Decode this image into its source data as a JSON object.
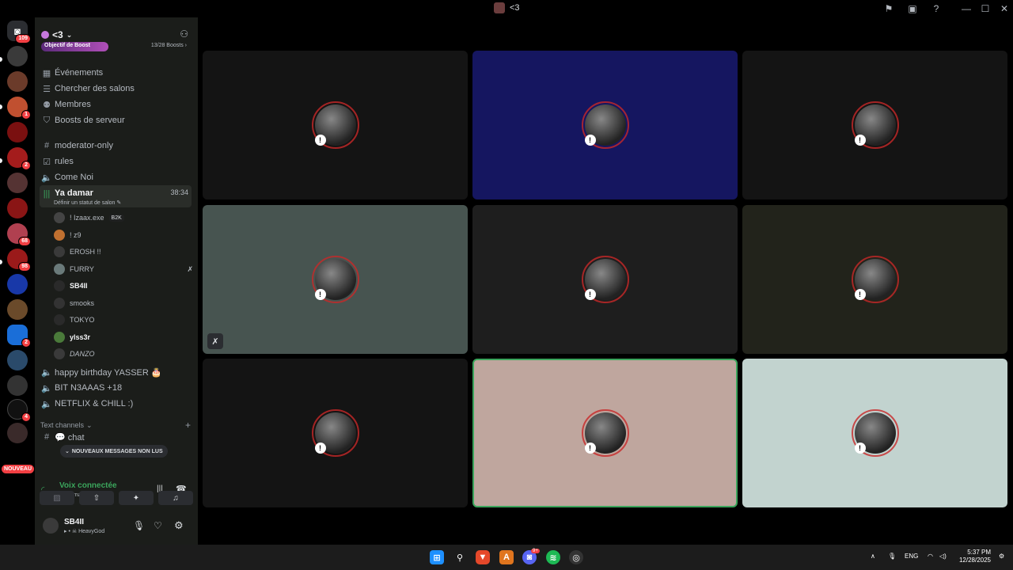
{
  "window": {
    "title": "<3"
  },
  "rail": {
    "home_badge": "109",
    "badges": [
      "1",
      "2",
      "68",
      "98",
      "2",
      "4"
    ],
    "new_label": "NOUVEAU"
  },
  "server": {
    "name": "<3",
    "boost_label": "Objectif de Boost",
    "boost_count": "13/28 Boosts",
    "boost_progress": 0.46
  },
  "nav": [
    {
      "icon": "calendar-icon",
      "label": "Événements"
    },
    {
      "icon": "search-channels-icon",
      "label": "Chercher des salons"
    },
    {
      "icon": "members-icon",
      "label": "Membres"
    },
    {
      "icon": "boost-icon",
      "label": "Boosts de serveur"
    }
  ],
  "channels": {
    "text": [
      {
        "label": "moderator-only",
        "icon": "hash-icon"
      },
      {
        "label": "rules",
        "icon": "rules-icon"
      },
      {
        "label": "Come Noi",
        "icon": "voice-icon"
      }
    ],
    "active": {
      "label": "Ya damar",
      "time": "38:34",
      "status": "Définir un statut de salon"
    },
    "voice_users": [
      {
        "name": "! Izaax.exe",
        "tag": "B2K"
      },
      {
        "name": "! z9"
      },
      {
        "name": "EROSH !!"
      },
      {
        "name": "FURRY",
        "muted": true
      },
      {
        "name": "SB4II"
      },
      {
        "name": "smooks"
      },
      {
        "name": "TOKYO"
      },
      {
        "name": "ylss3r"
      },
      {
        "name": "DANZO"
      }
    ],
    "more_voice": [
      {
        "label": "happy birthday YASSER 🎂"
      },
      {
        "label": "BIT N3AAAS +18"
      },
      {
        "label": "NETFLIX & CHILL :)"
      }
    ],
    "category": "Text channels",
    "text_after": [
      {
        "label": "💬 chat"
      }
    ],
    "unread_label": "NOUVEAUX MESSAGES NON LUS"
  },
  "voice_panel": {
    "status": "Voix connectée",
    "channel": "Ya damar / <3"
  },
  "user": {
    "name": "SB4II",
    "custom_status": "HeavyGod"
  },
  "tiles": [
    {
      "bg": "#141414"
    },
    {
      "bg": "#151660"
    },
    {
      "bg": "#141414"
    },
    {
      "bg": "#475450",
      "muted": true
    },
    {
      "bg": "#1e1e1e"
    },
    {
      "bg": "#22231b"
    },
    {
      "bg": "#141414"
    },
    {
      "bg": "#bfa69e",
      "speaking": true
    },
    {
      "bg": "#c2d3cf"
    }
  ],
  "taskbar": {
    "lang": "ENG",
    "time": "5:37 PM",
    "date": "12/28/2025",
    "discord_badge": "9+"
  }
}
